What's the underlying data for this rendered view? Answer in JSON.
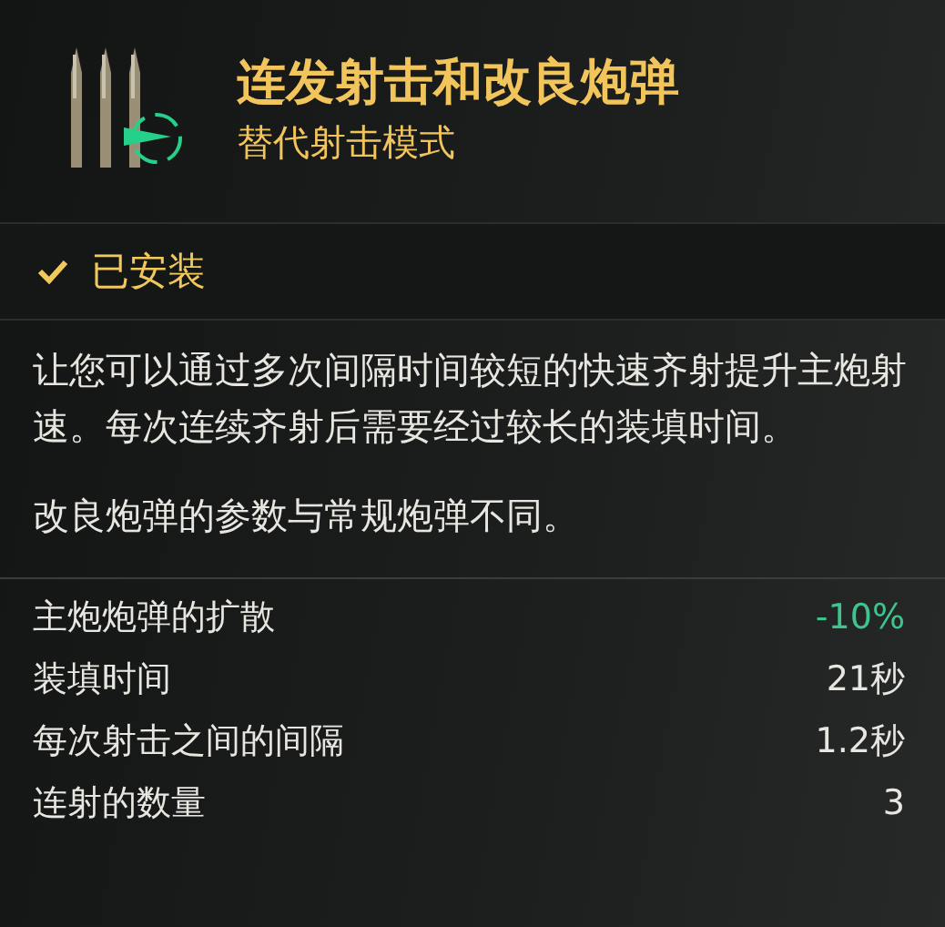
{
  "header": {
    "title": "连发射击和改良炮弹",
    "subtitle": "替代射击模式"
  },
  "status": {
    "installed": true,
    "label": "已安装"
  },
  "description": [
    "让您可以通过多次间隔时间较短的快速齐射提升主炮射速。每次连续齐射后需要经过较长的装填时间。",
    "改良炮弹的参数与常规炮弹不同。"
  ],
  "stats": [
    {
      "label": "主炮炮弹的扩散",
      "value": "-10%",
      "kind": "bonus"
    },
    {
      "label": "装填时间",
      "value": "21秒",
      "kind": "plain"
    },
    {
      "label": "每次射击之间的间隔",
      "value": "1.2秒",
      "kind": "plain"
    },
    {
      "label": "连射的数量",
      "value": "3",
      "kind": "plain"
    }
  ]
}
